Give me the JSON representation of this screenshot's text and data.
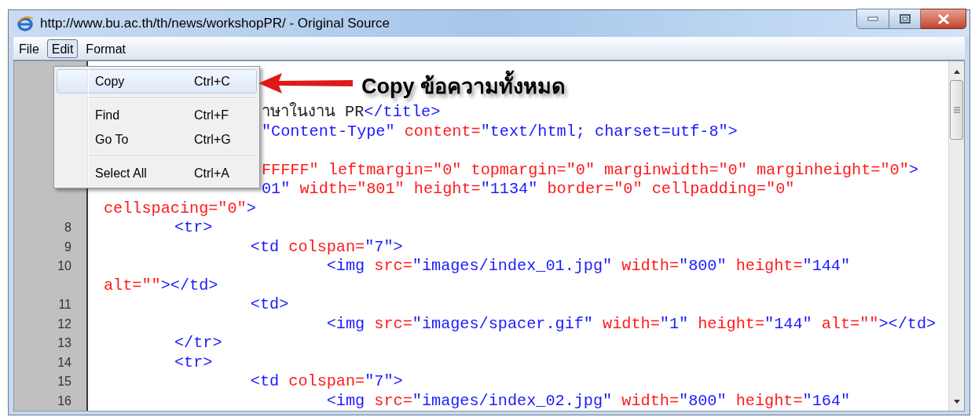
{
  "window": {
    "title": "http://www.bu.ac.th/th/news/workshopPR/ - Original Source"
  },
  "menubar": [
    {
      "label": "File",
      "open": false
    },
    {
      "label": "Edit",
      "open": true
    },
    {
      "label": "Format",
      "open": false
    }
  ],
  "dropdown": {
    "items": [
      {
        "kind": "item",
        "label": "Copy",
        "shortcut": "Ctrl+C",
        "selected": true
      },
      {
        "kind": "separator"
      },
      {
        "kind": "item",
        "label": "Find",
        "shortcut": "Ctrl+F",
        "selected": false
      },
      {
        "kind": "item",
        "label": "Go To",
        "shortcut": "Ctrl+G",
        "selected": false
      },
      {
        "kind": "separator"
      },
      {
        "kind": "item",
        "label": "Select All",
        "shortcut": "Ctrl+A",
        "selected": false
      }
    ]
  },
  "annotation": {
    "text": "Copy ข้อความทั้งหมด"
  },
  "code": {
    "rows": [
      {
        "kind": "blank"
      },
      {
        "kind": "blank"
      },
      {
        "kind": "clipped",
        "tokens": [
          {
            "kind": "text",
            "text": "าษาในงาน PR"
          },
          {
            "kind": "markup",
            "text": "</title>"
          }
        ]
      },
      {
        "kind": "clipped",
        "tokens": [
          {
            "kind": "markup",
            "text": "\"Content-Type\""
          },
          {
            "kind": "attribute",
            "text": " content="
          },
          {
            "kind": "markup",
            "text": "\"text/html; charset=utf-8\">"
          }
        ]
      },
      {
        "kind": "blank"
      },
      {
        "kind": "clipped",
        "tokens": [
          {
            "kind": "attribute",
            "text": "FFFFF\" leftmargin=\"0\" topmargin=\"0\" marginwidth=\"0\" marginheight=\"0\""
          },
          {
            "kind": "markup",
            "text": ">"
          }
        ]
      },
      {
        "kind": "clipped",
        "tokens": [
          {
            "kind": "markup",
            "text": "01\""
          },
          {
            "kind": "attribute",
            "text": " width=\"801\" height="
          },
          {
            "kind": "markup",
            "text": "\"1134\""
          },
          {
            "kind": "attribute",
            "text": " border=\"0\" cellpadding=\"0\""
          }
        ]
      },
      {
        "kind": "wrap",
        "tokens": [
          {
            "kind": "attribute",
            "text": "cellspacing=\"0\""
          },
          {
            "kind": "markup",
            "text": ">"
          }
        ]
      },
      {
        "kind": "line",
        "number": "8",
        "tokens": [
          {
            "kind": "markup",
            "text": "\t<tr>"
          }
        ]
      },
      {
        "kind": "line",
        "number": "9",
        "tokens": [
          {
            "kind": "markup",
            "text": "\t\t<td"
          },
          {
            "kind": "attribute",
            "text": " colspan="
          },
          {
            "kind": "markup",
            "text": "\"7\">"
          }
        ]
      },
      {
        "kind": "line",
        "number": "10",
        "tokens": [
          {
            "kind": "markup",
            "text": "\t\t\t<img"
          },
          {
            "kind": "attribute",
            "text": " src="
          },
          {
            "kind": "markup",
            "text": "\"images/index_01.jpg\""
          },
          {
            "kind": "attribute",
            "text": " width="
          },
          {
            "kind": "markup",
            "text": "\"800\""
          },
          {
            "kind": "attribute",
            "text": " height="
          },
          {
            "kind": "markup",
            "text": "\"144\""
          }
        ]
      },
      {
        "kind": "wrap",
        "tokens": [
          {
            "kind": "attribute",
            "text": "alt=\"\""
          },
          {
            "kind": "markup",
            "text": "></td>"
          }
        ]
      },
      {
        "kind": "line",
        "number": "11",
        "tokens": [
          {
            "kind": "markup",
            "text": "\t\t<td>"
          }
        ]
      },
      {
        "kind": "line",
        "number": "12",
        "tokens": [
          {
            "kind": "markup",
            "text": "\t\t\t<img"
          },
          {
            "kind": "attribute",
            "text": " src="
          },
          {
            "kind": "markup",
            "text": "\"images/spacer.gif\""
          },
          {
            "kind": "attribute",
            "text": " width="
          },
          {
            "kind": "markup",
            "text": "\"1\""
          },
          {
            "kind": "attribute",
            "text": " height="
          },
          {
            "kind": "markup",
            "text": "\"144\""
          },
          {
            "kind": "attribute",
            "text": " alt=\"\""
          },
          {
            "kind": "markup",
            "text": "></td>"
          }
        ]
      },
      {
        "kind": "line",
        "number": "13",
        "tokens": [
          {
            "kind": "markup",
            "text": "\t</tr>"
          }
        ]
      },
      {
        "kind": "line",
        "number": "14",
        "tokens": [
          {
            "kind": "markup",
            "text": "\t<tr>"
          }
        ]
      },
      {
        "kind": "line",
        "number": "15",
        "tokens": [
          {
            "kind": "markup",
            "text": "\t\t<td"
          },
          {
            "kind": "attribute",
            "text": " colspan="
          },
          {
            "kind": "markup",
            "text": "\"7\">"
          }
        ]
      },
      {
        "kind": "line",
        "number": "16",
        "tokens": [
          {
            "kind": "markup",
            "text": "\t\t\t<img"
          },
          {
            "kind": "attribute",
            "text": " src="
          },
          {
            "kind": "markup",
            "text": "\"images/index_02.jpg\""
          },
          {
            "kind": "attribute",
            "text": " width="
          },
          {
            "kind": "markup",
            "text": "\"800\""
          },
          {
            "kind": "attribute",
            "text": " height="
          },
          {
            "kind": "markup",
            "text": "\"164\""
          }
        ]
      }
    ]
  }
}
